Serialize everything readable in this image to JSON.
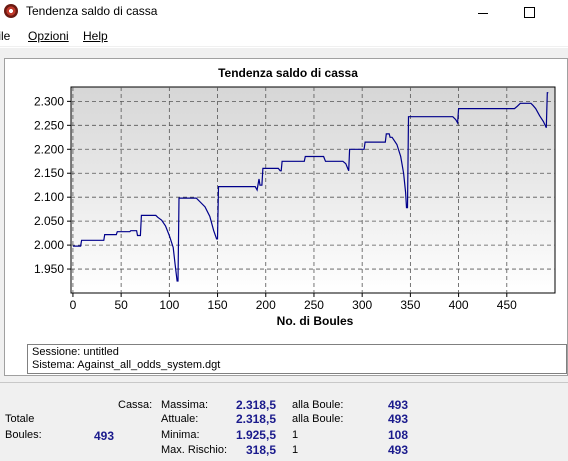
{
  "window": {
    "title": "Tendenza saldo di cassa"
  },
  "menu": {
    "file": "File",
    "opzioni": "Opzioni",
    "help": "Help"
  },
  "chart_data": {
    "type": "line",
    "title": "Tendenza saldo di cassa",
    "xlabel": "No. di Boules",
    "ylabel": "",
    "xlim": [
      -2,
      500
    ],
    "ylim": [
      1900,
      2330
    ],
    "x_ticks": [
      0,
      50,
      100,
      150,
      200,
      250,
      300,
      350,
      400,
      450
    ],
    "y_ticks": [
      1950,
      2000,
      2050,
      2100,
      2150,
      2200,
      2250,
      2300
    ],
    "x_tick_labels": [
      "0",
      "50",
      "100",
      "150",
      "200",
      "250",
      "300",
      "350",
      "400",
      "450"
    ],
    "y_tick_labels": [
      "1.950",
      "2.000",
      "2.050",
      "2.100",
      "2.150",
      "2.200",
      "2.250",
      "2.300"
    ],
    "grid": true,
    "line_color": "#00008b",
    "series": [
      {
        "x": [
          0,
          8,
          9,
          32,
          33,
          45,
          46,
          59,
          60,
          66,
          67,
          70,
          71,
          86,
          88,
          92,
          96,
          100,
          104,
          106,
          108,
          109,
          110,
          128,
          132,
          137,
          142,
          146,
          149,
          150,
          151,
          189,
          191,
          193,
          194,
          196,
          197,
          213,
          215,
          216,
          217,
          240,
          241,
          260,
          262,
          263,
          280,
          283,
          285,
          286,
          287,
          302,
          303,
          314,
          315,
          324,
          325,
          328,
          329,
          331,
          336,
          340,
          343,
          345,
          346,
          347,
          348,
          394,
          397,
          399,
          400,
          445,
          446,
          458,
          461,
          464,
          475,
          477,
          480,
          484,
          488,
          491,
          492,
          493
        ],
        "y": [
          1998,
          1998,
          2010,
          2010,
          2022,
          2022,
          2028,
          2028,
          2030,
          2030,
          2020,
          2020,
          2062,
          2062,
          2058,
          2052,
          2040,
          2020,
          1995,
          1960,
          1925,
          1925,
          2098,
          2098,
          2090,
          2080,
          2060,
          2030,
          2013,
          2013,
          2122,
          2122,
          2115,
          2138,
          2125,
          2125,
          2160,
          2160,
          2155,
          2155,
          2175,
          2175,
          2185,
          2185,
          2175,
          2175,
          2175,
          2170,
          2160,
          2155,
          2200,
          2200,
          2215,
          2215,
          2215,
          2215,
          2232,
          2232,
          2225,
          2225,
          2210,
          2185,
          2150,
          2110,
          2078,
          2078,
          2268,
          2268,
          2262,
          2255,
          2285,
          2285,
          2285,
          2285,
          2290,
          2296,
          2296,
          2292,
          2285,
          2270,
          2258,
          2245,
          2318,
          2318
        ]
      }
    ]
  },
  "session": {
    "sessione": "Sessione: untitled",
    "sistema": "Sistema: Against_all_odds_system.dgt"
  },
  "stats": {
    "cassa_label": "Cassa:",
    "totale_label": "Totale",
    "boules_label": "Boules:",
    "boules_value": "493",
    "massima_label": "Massima:",
    "massima_value": "2.318,5",
    "massima_at_label": "alla Boule:",
    "massima_at_value": "493",
    "attuale_label": "Attuale:",
    "attuale_value": "2.318,5",
    "attuale_at_label": "alla Boule:",
    "attuale_at_value": "493",
    "minima_label": "Minima:",
    "minima_value": "1.925,5",
    "minima_at_label": "1",
    "minima_at_value": "108",
    "rischio_label": "Max. Rischio:",
    "rischio_value": "318,5",
    "rischio_at_label": "1",
    "rischio_at_value": "493"
  }
}
